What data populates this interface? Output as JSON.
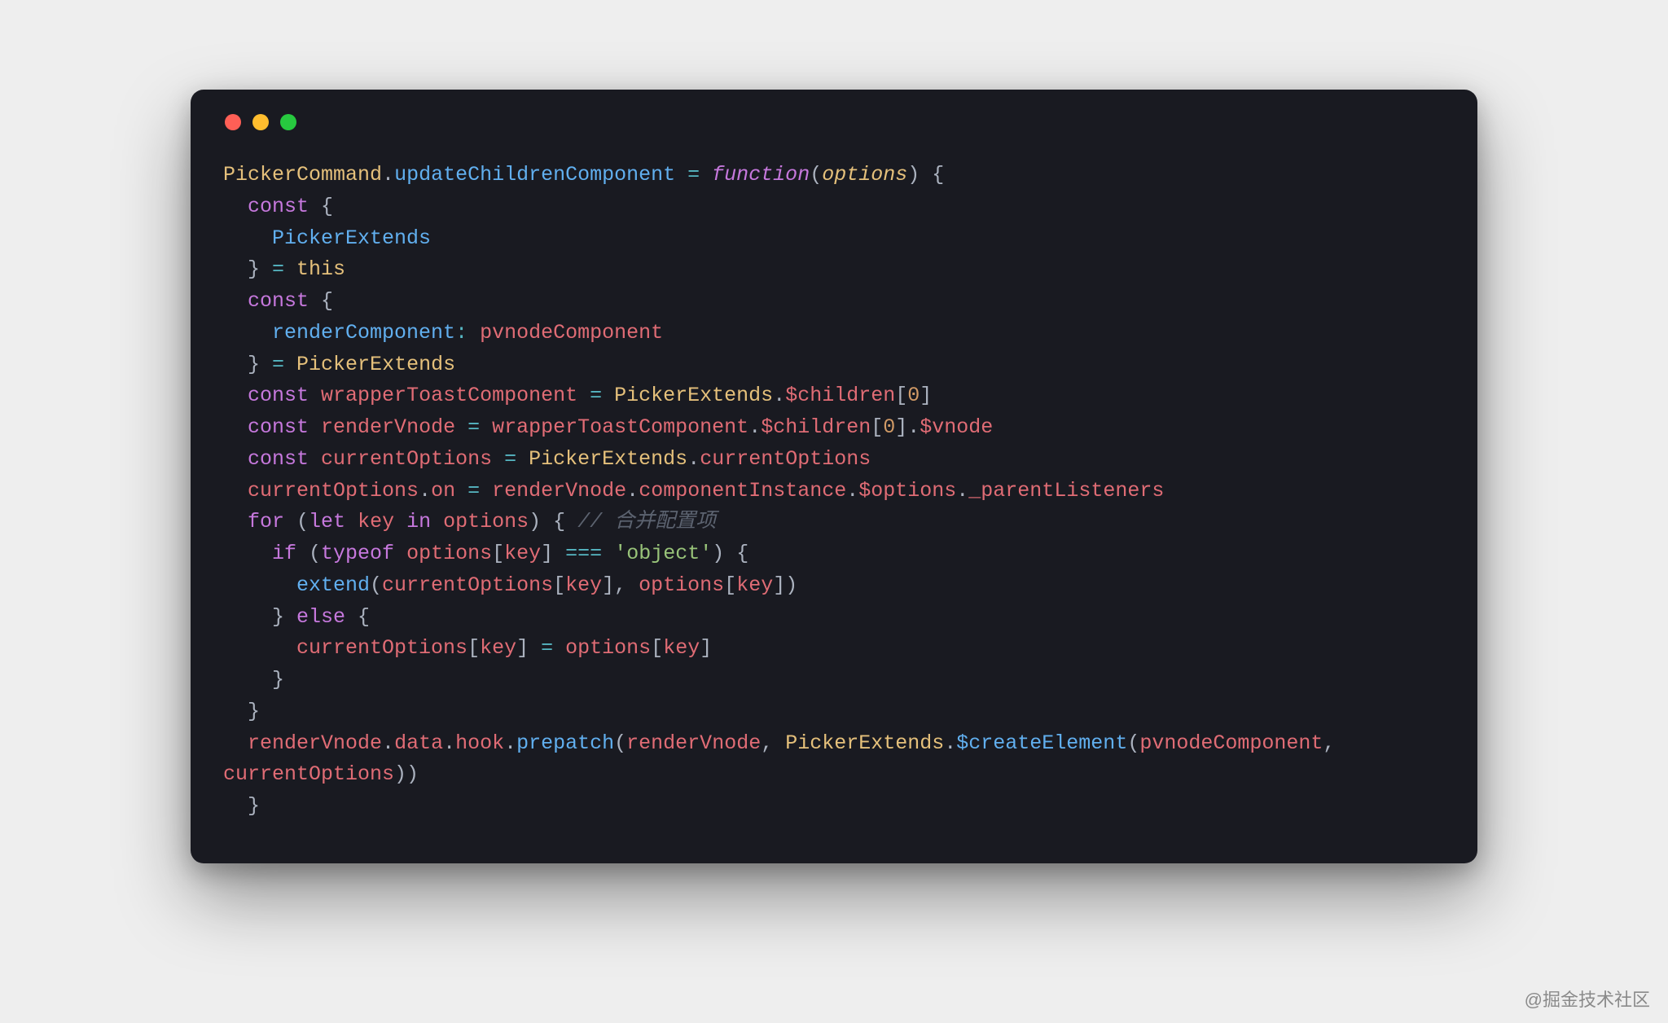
{
  "window": {
    "traffic_lights": [
      "red",
      "yellow",
      "green"
    ]
  },
  "watermark": "@掘金技术社区",
  "code_tokens": [
    [
      {
        "c": "tk-ident",
        "t": "PickerCommand"
      },
      {
        "c": "tk-punc",
        "t": "."
      },
      {
        "c": "tk-prop",
        "t": "updateChildrenComponent"
      },
      {
        "c": "tk-punc",
        "t": " "
      },
      {
        "c": "tk-op",
        "t": "="
      },
      {
        "c": "tk-punc",
        "t": " "
      },
      {
        "c": "tk-kwi",
        "t": "function"
      },
      {
        "c": "tk-punc",
        "t": "("
      },
      {
        "c": "tk-param",
        "t": "options"
      },
      {
        "c": "tk-punc",
        "t": ") {"
      }
    ],
    [
      {
        "c": "tk-punc",
        "t": "  "
      },
      {
        "c": "tk-kw",
        "t": "const"
      },
      {
        "c": "tk-punc",
        "t": " {"
      }
    ],
    [
      {
        "c": "tk-punc",
        "t": "    "
      },
      {
        "c": "tk-prop",
        "t": "PickerExtends"
      }
    ],
    [
      {
        "c": "tk-punc",
        "t": "  } "
      },
      {
        "c": "tk-op",
        "t": "="
      },
      {
        "c": "tk-punc",
        "t": " "
      },
      {
        "c": "tk-this",
        "t": "this"
      }
    ],
    [
      {
        "c": "tk-punc",
        "t": ""
      }
    ],
    [
      {
        "c": "tk-punc",
        "t": "  "
      },
      {
        "c": "tk-kw",
        "t": "const"
      },
      {
        "c": "tk-punc",
        "t": " {"
      }
    ],
    [
      {
        "c": "tk-punc",
        "t": "    "
      },
      {
        "c": "tk-prop",
        "t": "renderComponent"
      },
      {
        "c": "tk-op",
        "t": ":"
      },
      {
        "c": "tk-punc",
        "t": " "
      },
      {
        "c": "tk-var",
        "t": "pvnodeComponent"
      }
    ],
    [
      {
        "c": "tk-punc",
        "t": "  } "
      },
      {
        "c": "tk-op",
        "t": "="
      },
      {
        "c": "tk-punc",
        "t": " "
      },
      {
        "c": "tk-ident",
        "t": "PickerExtends"
      }
    ],
    [
      {
        "c": "tk-punc",
        "t": ""
      }
    ],
    [
      {
        "c": "tk-punc",
        "t": "  "
      },
      {
        "c": "tk-kw",
        "t": "const"
      },
      {
        "c": "tk-punc",
        "t": " "
      },
      {
        "c": "tk-var",
        "t": "wrapperToastComponent"
      },
      {
        "c": "tk-punc",
        "t": " "
      },
      {
        "c": "tk-op",
        "t": "="
      },
      {
        "c": "tk-punc",
        "t": " "
      },
      {
        "c": "tk-ident",
        "t": "PickerExtends"
      },
      {
        "c": "tk-punc",
        "t": "."
      },
      {
        "c": "tk-var",
        "t": "$children"
      },
      {
        "c": "tk-punc",
        "t": "["
      },
      {
        "c": "tk-num",
        "t": "0"
      },
      {
        "c": "tk-punc",
        "t": "]"
      }
    ],
    [
      {
        "c": "tk-punc",
        "t": "  "
      },
      {
        "c": "tk-kw",
        "t": "const"
      },
      {
        "c": "tk-punc",
        "t": " "
      },
      {
        "c": "tk-var",
        "t": "renderVnode"
      },
      {
        "c": "tk-punc",
        "t": " "
      },
      {
        "c": "tk-op",
        "t": "="
      },
      {
        "c": "tk-punc",
        "t": " "
      },
      {
        "c": "tk-var",
        "t": "wrapperToastComponent"
      },
      {
        "c": "tk-punc",
        "t": "."
      },
      {
        "c": "tk-var",
        "t": "$children"
      },
      {
        "c": "tk-punc",
        "t": "["
      },
      {
        "c": "tk-num",
        "t": "0"
      },
      {
        "c": "tk-punc",
        "t": "]."
      },
      {
        "c": "tk-var",
        "t": "$vnode"
      }
    ],
    [
      {
        "c": "tk-punc",
        "t": "  "
      },
      {
        "c": "tk-kw",
        "t": "const"
      },
      {
        "c": "tk-punc",
        "t": " "
      },
      {
        "c": "tk-var",
        "t": "currentOptions"
      },
      {
        "c": "tk-punc",
        "t": " "
      },
      {
        "c": "tk-op",
        "t": "="
      },
      {
        "c": "tk-punc",
        "t": " "
      },
      {
        "c": "tk-ident",
        "t": "PickerExtends"
      },
      {
        "c": "tk-punc",
        "t": "."
      },
      {
        "c": "tk-var",
        "t": "currentOptions"
      }
    ],
    [
      {
        "c": "tk-punc",
        "t": "  "
      },
      {
        "c": "tk-var",
        "t": "currentOptions"
      },
      {
        "c": "tk-punc",
        "t": "."
      },
      {
        "c": "tk-var",
        "t": "on"
      },
      {
        "c": "tk-punc",
        "t": " "
      },
      {
        "c": "tk-op",
        "t": "="
      },
      {
        "c": "tk-punc",
        "t": " "
      },
      {
        "c": "tk-var",
        "t": "renderVnode"
      },
      {
        "c": "tk-punc",
        "t": "."
      },
      {
        "c": "tk-var",
        "t": "componentInstance"
      },
      {
        "c": "tk-punc",
        "t": "."
      },
      {
        "c": "tk-var",
        "t": "$options"
      },
      {
        "c": "tk-punc",
        "t": "."
      },
      {
        "c": "tk-var",
        "t": "_parentListeners"
      }
    ],
    [
      {
        "c": "tk-punc",
        "t": "  "
      },
      {
        "c": "tk-kw",
        "t": "for"
      },
      {
        "c": "tk-punc",
        "t": " ("
      },
      {
        "c": "tk-kw",
        "t": "let"
      },
      {
        "c": "tk-punc",
        "t": " "
      },
      {
        "c": "tk-var",
        "t": "key"
      },
      {
        "c": "tk-punc",
        "t": " "
      },
      {
        "c": "tk-kw",
        "t": "in"
      },
      {
        "c": "tk-punc",
        "t": " "
      },
      {
        "c": "tk-var",
        "t": "options"
      },
      {
        "c": "tk-punc",
        "t": ") { "
      },
      {
        "c": "tk-comment",
        "t": "// 合并配置项"
      }
    ],
    [
      {
        "c": "tk-punc",
        "t": "    "
      },
      {
        "c": "tk-kw",
        "t": "if"
      },
      {
        "c": "tk-punc",
        "t": " ("
      },
      {
        "c": "tk-kw",
        "t": "typeof"
      },
      {
        "c": "tk-punc",
        "t": " "
      },
      {
        "c": "tk-var",
        "t": "options"
      },
      {
        "c": "tk-punc",
        "t": "["
      },
      {
        "c": "tk-var",
        "t": "key"
      },
      {
        "c": "tk-punc",
        "t": "] "
      },
      {
        "c": "tk-op",
        "t": "==="
      },
      {
        "c": "tk-punc",
        "t": " "
      },
      {
        "c": "tk-str",
        "t": "'object'"
      },
      {
        "c": "tk-punc",
        "t": ") {"
      }
    ],
    [
      {
        "c": "tk-punc",
        "t": "      "
      },
      {
        "c": "tk-prop",
        "t": "extend"
      },
      {
        "c": "tk-punc",
        "t": "("
      },
      {
        "c": "tk-var",
        "t": "currentOptions"
      },
      {
        "c": "tk-punc",
        "t": "["
      },
      {
        "c": "tk-var",
        "t": "key"
      },
      {
        "c": "tk-punc",
        "t": "], "
      },
      {
        "c": "tk-var",
        "t": "options"
      },
      {
        "c": "tk-punc",
        "t": "["
      },
      {
        "c": "tk-var",
        "t": "key"
      },
      {
        "c": "tk-punc",
        "t": "])"
      }
    ],
    [
      {
        "c": "tk-punc",
        "t": "    } "
      },
      {
        "c": "tk-kw",
        "t": "else"
      },
      {
        "c": "tk-punc",
        "t": " {"
      }
    ],
    [
      {
        "c": "tk-punc",
        "t": "      "
      },
      {
        "c": "tk-var",
        "t": "currentOptions"
      },
      {
        "c": "tk-punc",
        "t": "["
      },
      {
        "c": "tk-var",
        "t": "key"
      },
      {
        "c": "tk-punc",
        "t": "] "
      },
      {
        "c": "tk-op",
        "t": "="
      },
      {
        "c": "tk-punc",
        "t": " "
      },
      {
        "c": "tk-var",
        "t": "options"
      },
      {
        "c": "tk-punc",
        "t": "["
      },
      {
        "c": "tk-var",
        "t": "key"
      },
      {
        "c": "tk-punc",
        "t": "]"
      }
    ],
    [
      {
        "c": "tk-punc",
        "t": "    }"
      }
    ],
    [
      {
        "c": "tk-punc",
        "t": "  }"
      }
    ],
    [
      {
        "c": "tk-punc",
        "t": ""
      }
    ],
    [
      {
        "c": "tk-punc",
        "t": "  "
      },
      {
        "c": "tk-var",
        "t": "renderVnode"
      },
      {
        "c": "tk-punc",
        "t": "."
      },
      {
        "c": "tk-var",
        "t": "data"
      },
      {
        "c": "tk-punc",
        "t": "."
      },
      {
        "c": "tk-var",
        "t": "hook"
      },
      {
        "c": "tk-punc",
        "t": "."
      },
      {
        "c": "tk-prop",
        "t": "prepatch"
      },
      {
        "c": "tk-punc",
        "t": "("
      },
      {
        "c": "tk-var",
        "t": "renderVnode"
      },
      {
        "c": "tk-punc",
        "t": ", "
      },
      {
        "c": "tk-ident",
        "t": "PickerExtends"
      },
      {
        "c": "tk-punc",
        "t": "."
      },
      {
        "c": "tk-prop",
        "t": "$createElement"
      },
      {
        "c": "tk-punc",
        "t": "("
      },
      {
        "c": "tk-var",
        "t": "pvnodeComponent"
      },
      {
        "c": "tk-punc",
        "t": ", "
      }
    ],
    [
      {
        "c": "tk-var",
        "t": "currentOptions"
      },
      {
        "c": "tk-punc",
        "t": "))"
      }
    ],
    [
      {
        "c": "tk-punc",
        "t": "  }"
      }
    ]
  ]
}
